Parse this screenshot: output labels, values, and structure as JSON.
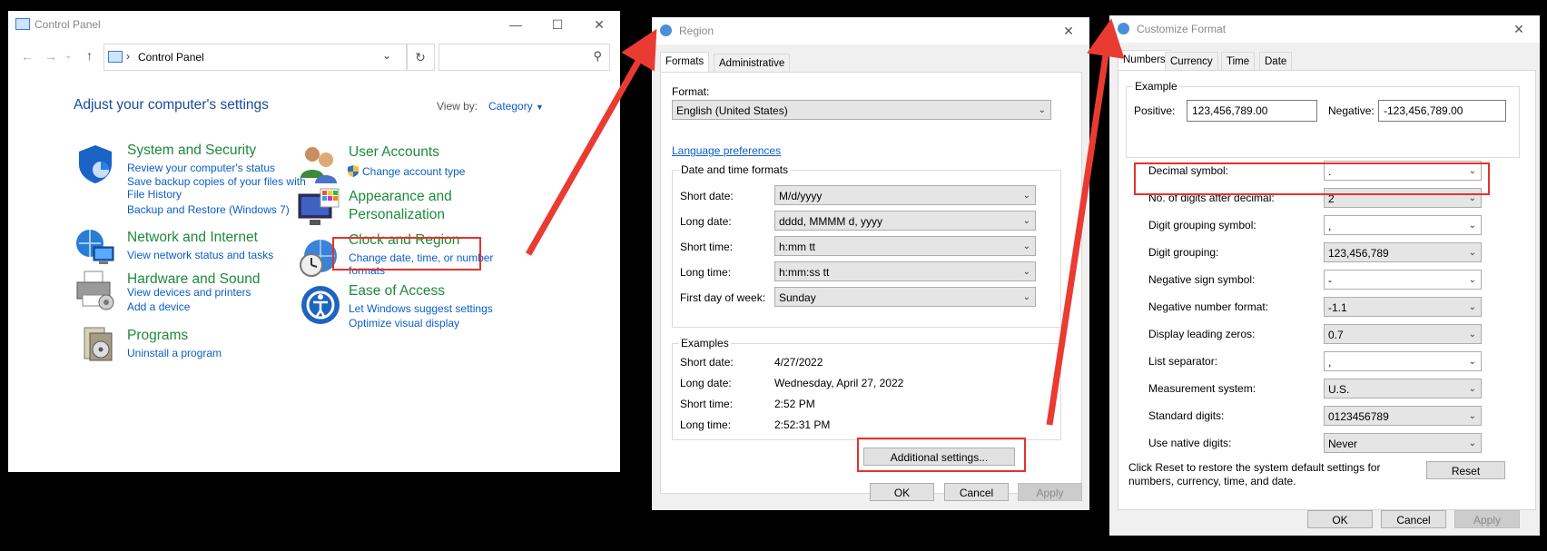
{
  "colors": {
    "accent_red": "#e5322d",
    "link": "#0b5ec9",
    "heading_green": "#1d8a3a",
    "dialog_bg": "#f0f0f0"
  },
  "control_panel": {
    "title": "Control Panel",
    "address": "Control Panel",
    "header": "Adjust your computer's settings",
    "view_by_label": "View by:",
    "view_by_value": "Category",
    "categories": [
      {
        "title": "System and Security",
        "icon": "shield-icon",
        "links": [
          "Review your computer's status",
          "Save backup copies of your files with",
          "File History",
          "Backup and Restore (Windows 7)"
        ]
      },
      {
        "title": "Network and Internet",
        "icon": "globe-network-icon",
        "links": [
          "View network status and tasks"
        ]
      },
      {
        "title": "Hardware and Sound",
        "icon": "printer-icon",
        "links": [
          "View devices and printers",
          "Add a device"
        ]
      },
      {
        "title": "Programs",
        "icon": "programs-icon",
        "links": [
          "Uninstall a program"
        ]
      },
      {
        "title": "User Accounts",
        "icon": "users-icon",
        "links": [
          "Change account type"
        ]
      },
      {
        "title": "Appearance and",
        "title2": "Personalization",
        "icon": "monitor-palette-icon",
        "links": []
      },
      {
        "title": "Clock and Region",
        "icon": "clock-globe-icon",
        "links": [
          "Change date, time, or number",
          "formats"
        ]
      },
      {
        "title": "Ease of Access",
        "icon": "ease-of-access-icon",
        "links": [
          "Let Windows suggest settings",
          "Optimize visual display"
        ]
      }
    ]
  },
  "region": {
    "title": "Region",
    "tabs": [
      "Formats",
      "Administrative"
    ],
    "format_label": "Format:",
    "format_value": "English (United States)",
    "language_link": "Language preferences",
    "dt_group": "Date and time formats",
    "dt_rows": [
      {
        "label": "Short date:",
        "value": "M/d/yyyy"
      },
      {
        "label": "Long date:",
        "value": "dddd, MMMM d, yyyy"
      },
      {
        "label": "Short time:",
        "value": "h:mm tt"
      },
      {
        "label": "Long time:",
        "value": "h:mm:ss tt"
      },
      {
        "label": "First day of week:",
        "value": "Sunday"
      }
    ],
    "ex_group": "Examples",
    "examples": [
      {
        "label": "Short date:",
        "value": "4/27/2022"
      },
      {
        "label": "Long date:",
        "value": "Wednesday, April 27, 2022"
      },
      {
        "label": "Short time:",
        "value": "2:52 PM"
      },
      {
        "label": "Long time:",
        "value": "2:52:31 PM"
      }
    ],
    "additional_btn": "Additional settings...",
    "ok": "OK",
    "cancel": "Cancel",
    "apply": "Apply"
  },
  "customize": {
    "title": "Customize Format",
    "tabs": [
      "Numbers",
      "Currency",
      "Time",
      "Date"
    ],
    "example_group": "Example",
    "positive_label": "Positive:",
    "positive_value": "123,456,789.00",
    "negative_label": "Negative:",
    "negative_value": "-123,456,789.00",
    "rows": [
      {
        "label": "Decimal symbol:",
        "value": "."
      },
      {
        "label": "No. of digits after decimal:",
        "value": "2"
      },
      {
        "label": "Digit grouping symbol:",
        "value": ","
      },
      {
        "label": "Digit grouping:",
        "value": "123,456,789"
      },
      {
        "label": "Negative sign symbol:",
        "value": "-"
      },
      {
        "label": "Negative number format:",
        "value": "-1.1"
      },
      {
        "label": "Display leading zeros:",
        "value": "0.7"
      },
      {
        "label": "List separator:",
        "value": ","
      },
      {
        "label": "Measurement system:",
        "value": "U.S."
      },
      {
        "label": "Standard digits:",
        "value": "0123456789"
      },
      {
        "label": "Use native digits:",
        "value": "Never"
      }
    ],
    "reset_text_1": "Click Reset to restore the system default settings for",
    "reset_text_2": "numbers, currency, time, and date.",
    "reset": "Reset",
    "ok": "OK",
    "cancel": "Cancel",
    "apply": "Apply"
  }
}
